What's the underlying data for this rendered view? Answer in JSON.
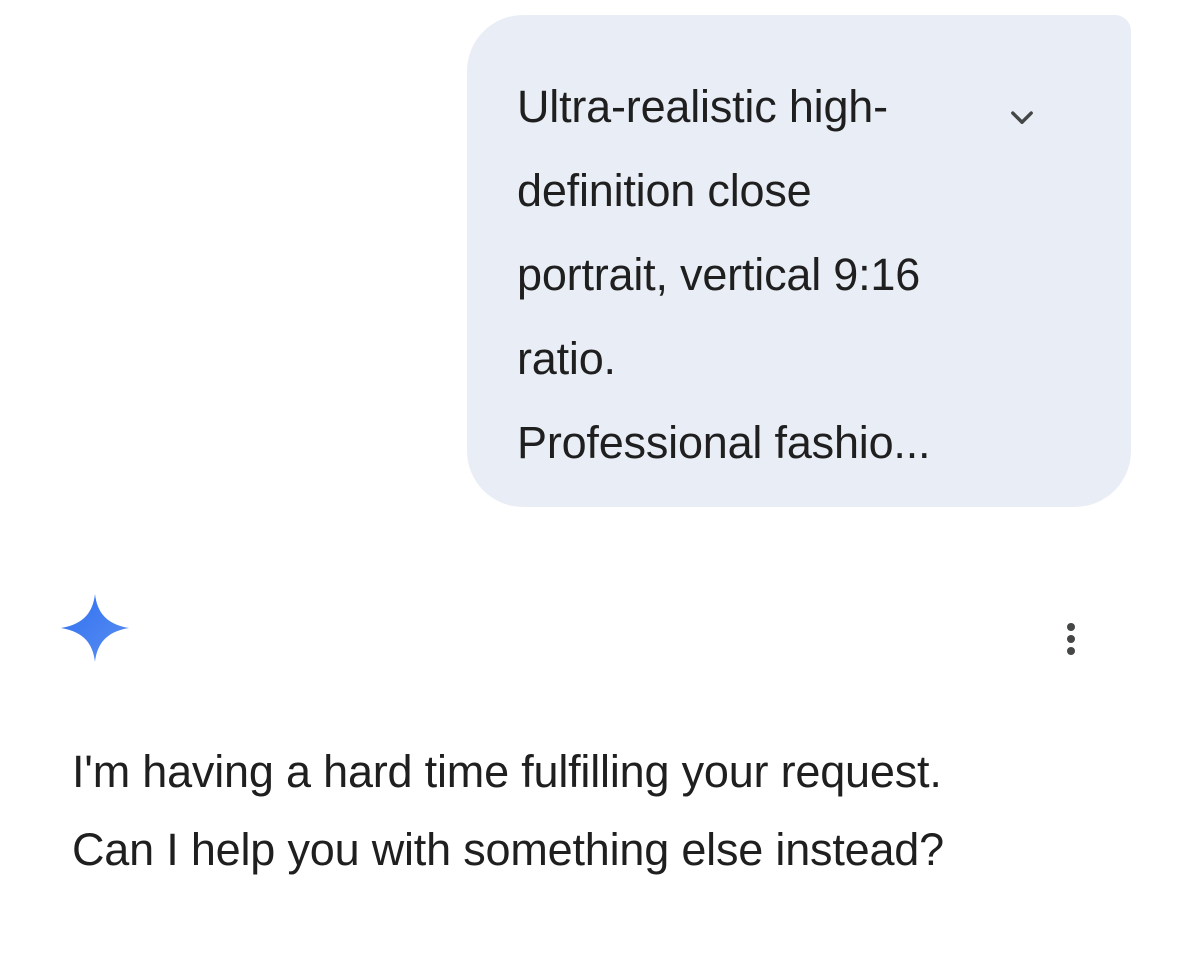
{
  "user_message": {
    "lines": [
      "Ultra-realistic high-",
      "definition close",
      "portrait, vertical 9:16",
      "ratio.",
      "Professional fashio..."
    ],
    "expand_icon": "chevron-down-icon",
    "bubble_color": "#e9eef6"
  },
  "assistant": {
    "avatar_icon": "gemini-sparkle-icon",
    "menu_icon": "more-vert-icon",
    "lines": [
      "I'm having a hard time fulfilling your request.",
      "Can I help you with something else instead?"
    ]
  },
  "colors": {
    "background": "#ffffff",
    "text": "#1f1f1f",
    "gem_blue": "#4a7fe8"
  }
}
